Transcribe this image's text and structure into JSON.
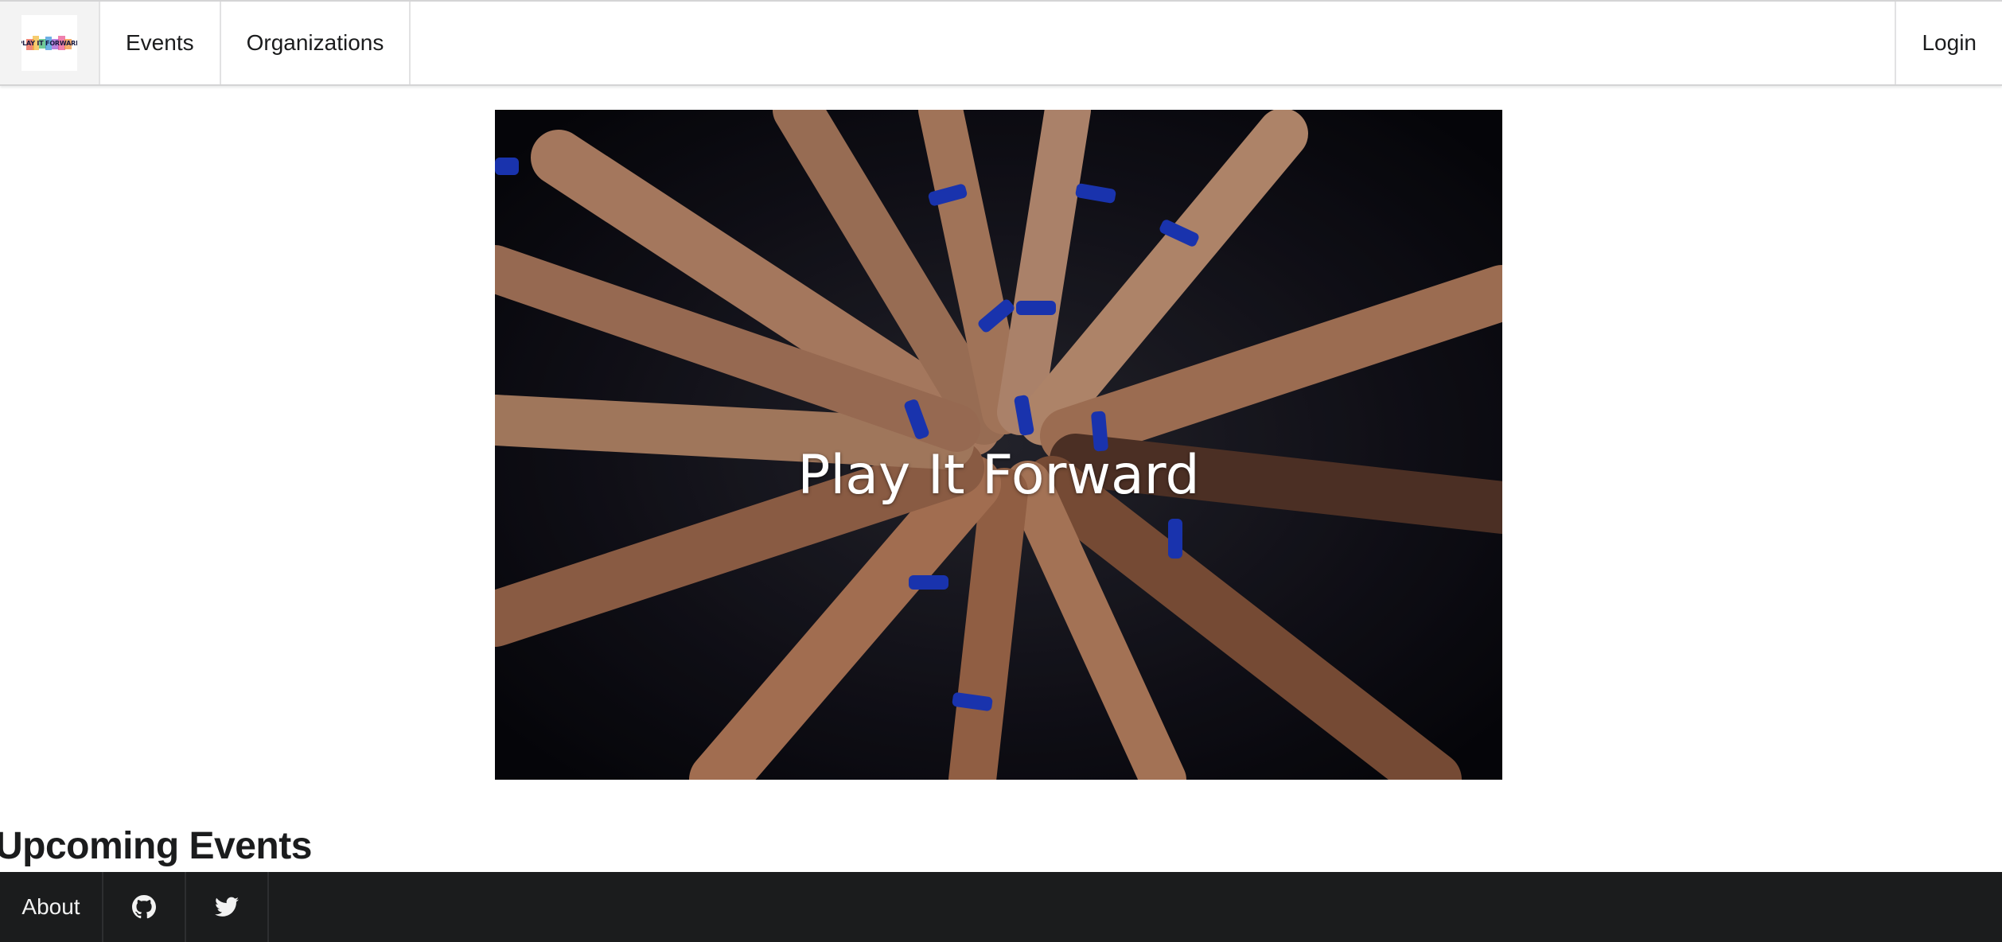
{
  "nav": {
    "logo_text": "PLAY IT FORWARD",
    "items": [
      {
        "label": "Events"
      },
      {
        "label": "Organizations"
      }
    ],
    "login_label": "Login"
  },
  "hero": {
    "title": "Play It Forward"
  },
  "upcoming": {
    "heading": "Upcoming Events"
  },
  "footer": {
    "about_label": "About",
    "icons": [
      "github-icon",
      "twitter-icon"
    ]
  },
  "colors": {
    "footer_bg": "#1b1c1d",
    "wristband_blue": "#1f3fd4",
    "nav_border": "#d4d4d5"
  }
}
